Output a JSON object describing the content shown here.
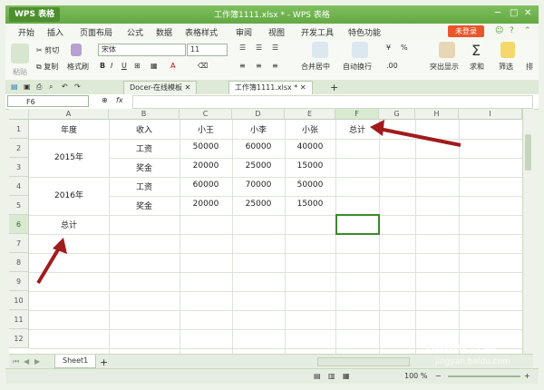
{
  "app": {
    "badge": "WPS 表格",
    "doc_title": "工作簿1111.xlsx * - WPS 表格"
  },
  "menu": [
    "开始",
    "插入",
    "页面布局",
    "公式",
    "数据",
    "表格样式",
    "审阅",
    "视图",
    "开发工具",
    "特色功能"
  ],
  "login_label": "未登录",
  "ribbon": {
    "cut": "剪切",
    "copy": "复制",
    "format_painter": "格式刷",
    "paste": "粘贴",
    "font_name": "宋体",
    "font_size": "11",
    "merge_center": "合并居中",
    "wrap": "自动换行",
    "percent": "%",
    "cond_format": "突出显示",
    "sum": "求和",
    "filter": "筛选",
    "sort": "排"
  },
  "tabs": [
    {
      "label": "Docer-在线模板"
    },
    {
      "label": "工作簿1111.xlsx *"
    }
  ],
  "name_box": "F6",
  "fx_label": "fx",
  "columns": [
    "A",
    "B",
    "C",
    "D",
    "E",
    "F",
    "G",
    "H",
    "I"
  ],
  "rows": [
    "1",
    "2",
    "3",
    "4",
    "5",
    "6",
    "7",
    "8",
    "9",
    "10",
    "11",
    "12"
  ],
  "cells": {
    "A1": "年度",
    "B1": "收入",
    "C1": "小王",
    "D1": "小李",
    "E1": "小张",
    "F1": "总计",
    "A2_3": "2015年",
    "B2": "工资",
    "C2": "50000",
    "D2": "60000",
    "E2": "40000",
    "B3": "奖金",
    "C3": "20000",
    "D3": "25000",
    "E3": "15000",
    "A4_5": "2016年",
    "B4": "工资",
    "C4": "60000",
    "D4": "70000",
    "E4": "50000",
    "B5": "奖金",
    "C5": "20000",
    "D5": "25000",
    "E5": "15000",
    "A6": "总计"
  },
  "sheet_tab": "Sheet1",
  "zoom": "100 %",
  "watermark": "Baidu 经验",
  "watermark_url": "jingyan.baidu.com",
  "colors": {
    "accent": "#63a843",
    "arrow": "#a01c1c",
    "selection": "#3b8a2a",
    "login": "#e8562a"
  }
}
